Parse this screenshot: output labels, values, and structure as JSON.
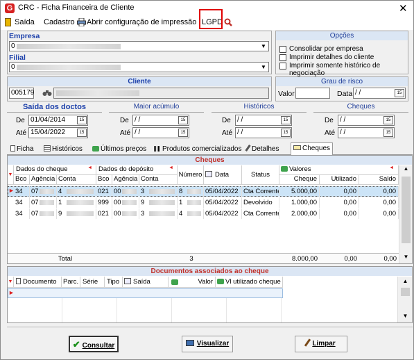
{
  "window": {
    "title": "CRC - Ficha Financeira de Cliente",
    "close_glyph": "✕"
  },
  "menu": {
    "saida": "Saída",
    "cadastro": "Cadastro",
    "abrir": "Abrir configuração de impressão",
    "lgpd": "LGPD"
  },
  "empresa": {
    "label": "Empresa",
    "value": "0"
  },
  "filial": {
    "label": "Filial",
    "value": "0"
  },
  "opcoes": {
    "title": "Opções",
    "items": [
      "Consolidar por empresa",
      "Imprimir detalhes do cliente",
      "Imprimir somente histórico de negociação"
    ]
  },
  "cliente": {
    "title": "Cliente",
    "code": "005179"
  },
  "grau": {
    "title": "Grau de risco",
    "valor_label": "Valor",
    "data_label": "Data",
    "data_value": " / /"
  },
  "saida_doctos": {
    "title": "Saída dos doctos",
    "de_label": "De",
    "de_value": "01/04/2014",
    "ate_label": "Até",
    "ate_value": "15/04/2022"
  },
  "maior_acumulo": {
    "title": "Maior acúmulo",
    "de_label": "De",
    "de_value": " / /",
    "ate_label": "Até",
    "ate_value": " / /"
  },
  "historicos": {
    "title": "Históricos",
    "de_label": "De",
    "de_value": " / /",
    "ate_label": "Até",
    "ate_value": " / /"
  },
  "cheques_dates": {
    "title": "Cheques",
    "de_label": "De",
    "de_value": " / /",
    "ate_label": "Até",
    "ate_value": " / /"
  },
  "tabs": [
    "Ficha",
    "Históricos",
    "Últimos preços",
    "Produtos comercializados",
    "Detalhes",
    "Cheques"
  ],
  "cheques_grid": {
    "title": "Cheques",
    "group_headers": {
      "dados_cheque": "Dados do cheque",
      "dados_deposito": "Dados do depósito",
      "valores": "Valores"
    },
    "columns": [
      "Bco",
      "Agência",
      "Conta",
      "Bco",
      "Agência",
      "Conta",
      "Número",
      "Data",
      "Status",
      "Cheque",
      "Utilizado",
      "Saldo"
    ],
    "rows": [
      [
        "34",
        "07",
        "4",
        "021",
        "00",
        "3",
        "8",
        "05/04/2022",
        "Cta Corrente",
        "5.000,00",
        "0,00",
        "0,00"
      ],
      [
        "34",
        "07",
        "1",
        "999",
        "00",
        "9",
        "1",
        "05/04/2022",
        "Devolvido",
        "1.000,00",
        "0,00",
        "0,00"
      ],
      [
        "34",
        "07",
        "9",
        "021",
        "00",
        "3",
        "4",
        "05/04/2022",
        "Cta Corrente",
        "2.000,00",
        "0,00",
        "0,00"
      ]
    ],
    "footer": {
      "label": "Total",
      "count": "3",
      "cheque": "8.000,00",
      "utilizado": "0,00",
      "saldo": "0,00"
    }
  },
  "docs_grid": {
    "title": "Documentos associados ao cheque",
    "columns": [
      "Documento",
      "Parc.",
      "Série",
      "Tipo",
      "Saída",
      "Valor",
      "Vl utilizado cheque"
    ]
  },
  "buttons": {
    "consultar": "Consultar",
    "visualizar": "Visualizar",
    "limpar": "Limpar"
  },
  "colors": {
    "accent_blue": "#1b3faa",
    "header_bg": "#dbe6f4",
    "selection": "#cce4f7",
    "highlight_box": "#e00000"
  }
}
